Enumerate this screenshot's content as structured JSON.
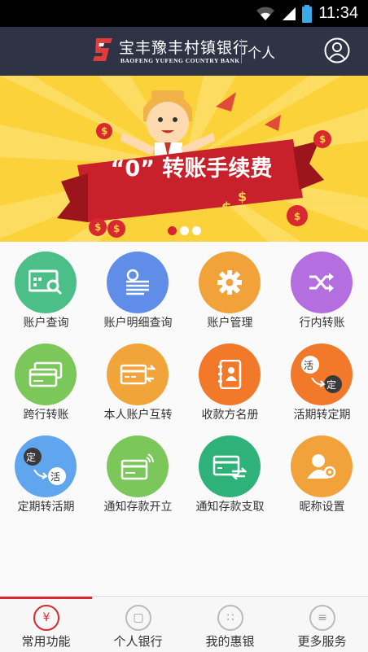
{
  "status_bar": {
    "time": "11:34"
  },
  "header": {
    "bank_name": "宝丰豫丰村镇银行",
    "bank_name_en": "BAOFENG YUFENG COUNTRY BANK",
    "mode": "个人"
  },
  "banner": {
    "title": "“0” 转账手续费",
    "slides": 3,
    "active_slide": 1
  },
  "grid": {
    "items": [
      {
        "label": "账户查询",
        "icon": "account-query-icon",
        "color": "#4bbf87"
      },
      {
        "label": "账户明细查询",
        "icon": "account-details-icon",
        "color": "#5f8de8"
      },
      {
        "label": "账户管理",
        "icon": "gear-icon",
        "color": "#f1a33a"
      },
      {
        "label": "行内转账",
        "icon": "shuffle-icon",
        "color": "#b46ee0"
      },
      {
        "label": "跨行转账",
        "icon": "interbank-transfer-icon",
        "color": "#7cc75a"
      },
      {
        "label": "本人账户互转",
        "icon": "own-transfer-icon",
        "color": "#f0a43a"
      },
      {
        "label": "收款方名册",
        "icon": "contacts-book-icon",
        "color": "#f2782a"
      },
      {
        "label": "活期转定期",
        "icon": "current-to-fixed-icon",
        "color": "#f2782a",
        "badge_a": "活",
        "badge_b": "定"
      },
      {
        "label": "定期转活期",
        "icon": "fixed-to-current-icon",
        "color": "#5fa6ef",
        "badge_a": "定",
        "badge_b": "活"
      },
      {
        "label": "通知存款开立",
        "icon": "notice-deposit-open-icon",
        "color": "#7cc75a"
      },
      {
        "label": "通知存款支取",
        "icon": "notice-deposit-withdraw-icon",
        "color": "#2fb27a"
      },
      {
        "label": "昵称设置",
        "icon": "nickname-settings-icon",
        "color": "#f2a23a"
      }
    ]
  },
  "tabbar": {
    "tabs": [
      {
        "label": "常用功能",
        "icon_glyph": "¥",
        "icon": "yuan-icon"
      },
      {
        "label": "个人银行",
        "icon_glyph": "▢",
        "icon": "monitor-icon"
      },
      {
        "label": "我的惠银",
        "icon_glyph": "∷",
        "icon": "apps-icon"
      },
      {
        "label": "更多服务",
        "icon_glyph": "≡",
        "icon": "menu-icon"
      }
    ],
    "active_index": 0
  },
  "colors": {
    "header_bg": "#2e3345",
    "accent": "#d62a30",
    "banner_bg": "#fcd23b"
  }
}
